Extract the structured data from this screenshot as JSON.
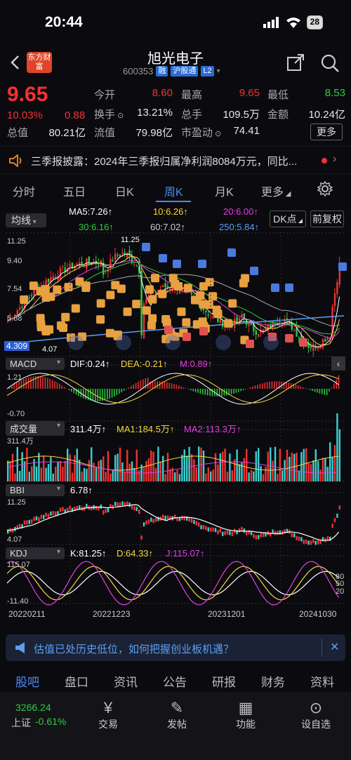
{
  "status": {
    "time": "20:44",
    "battery": "28"
  },
  "header": {
    "logo": "东方财富",
    "title": "旭光电子",
    "code": "600353",
    "tags": [
      "融",
      "沪股通",
      "L2"
    ]
  },
  "quote": {
    "price": "9.65",
    "pct": "10.03%",
    "chg": "0.88",
    "open_label": "今开",
    "open": "8.60",
    "high_label": "最高",
    "high": "9.65",
    "low_label": "最低",
    "low": "8.53",
    "turnover_label": "换手",
    "turnover": "13.21%",
    "volume_label": "总手",
    "volume": "109.5万",
    "amount_label": "金额",
    "amount": "10.24亿",
    "mcap_label": "总值",
    "mcap": "80.21亿",
    "float_label": "流值",
    "float": "79.98亿",
    "pe_label": "市盈动",
    "pe": "74.41",
    "more": "更多"
  },
  "notice": {
    "text": "三季报披露：2024年三季报归属净利润8084万元，同比..."
  },
  "tabs": [
    "分时",
    "五日",
    "日K",
    "周K",
    "月K",
    "更多",
    "设置"
  ],
  "chart_header": {
    "selector": "均线",
    "ma5": "MA5:7.26↑",
    "ma10": "10:6.26↑",
    "ma20": "20:6.00↑",
    "ma30": "30:6.16↑",
    "ma60": "60:7.02↑",
    "ma250": "250:5.84↑",
    "dk": "DK点",
    "fq": "前复权"
  },
  "colors": {
    "up": "#f03232",
    "down": "#2ecc40",
    "accent": "#4a8af4",
    "ma5": "#ffffff",
    "ma10": "#f5d742",
    "ma20": "#e040e0",
    "ma30": "#2ecc40",
    "ma250": "#5c9ef5"
  },
  "main_axis": {
    "top": "11.25",
    "mid1": "9.40",
    "mid2": "7.54",
    "mid3": "5.68",
    "low_marker": "4.309",
    "low_label": "4.07",
    "high_label": "11.25"
  },
  "macd": {
    "name": "MACD",
    "dif": "DIF:0.24↑",
    "dea": "DEA:-0.21↑",
    "m": "M:0.89↑",
    "top": "1.21",
    "bottom": "-0.70"
  },
  "volume": {
    "name": "成交量",
    "v": "311.4万↑",
    "ma1": "MA1:184.5万↑",
    "ma2": "MA2:113.3万↑",
    "top": "311.4万"
  },
  "bbi": {
    "name": "BBI",
    "v": "6.78↑",
    "top": "11.25",
    "bottom": "4.07"
  },
  "kdj": {
    "name": "KDJ",
    "k": "K:81.25↑",
    "d": "D:64.33↑",
    "j": "J:115.07↑",
    "top": "115.07",
    "bottom": "-11.40",
    "l80": "80",
    "l50": "50",
    "l20": "20"
  },
  "dates": [
    "20220211",
    "20221223",
    "20231201",
    "20241030"
  ],
  "ad": {
    "text": "估值已处历史低位，如何把握创业板机遇？"
  },
  "nav_tabs": [
    "股吧",
    "盘口",
    "资讯",
    "公告",
    "研报",
    "财务",
    "资料"
  ],
  "index": {
    "value": "3266.24",
    "name": "上证",
    "pct": "-0.61%"
  },
  "bottom_items": [
    "交易",
    "发帖",
    "功能",
    "设自选"
  ],
  "icons": [
    "back-icon",
    "share-icon",
    "search-icon",
    "speaker-icon",
    "gear-icon",
    "close-icon"
  ]
}
